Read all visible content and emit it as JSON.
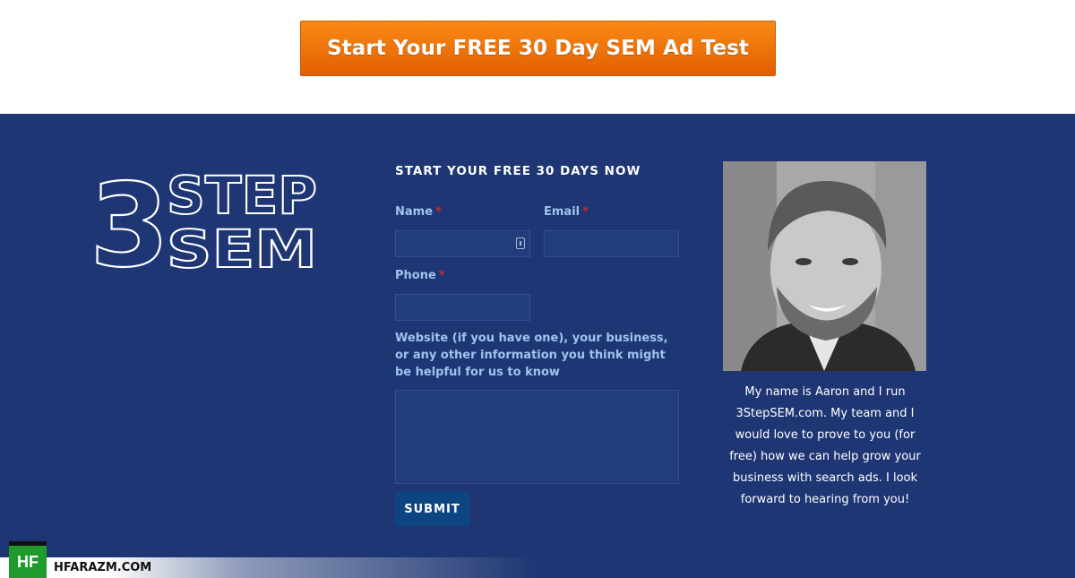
{
  "hero": {
    "cta_label": "Start Your FREE 30 Day SEM Ad Test"
  },
  "logo": {
    "digit": "3",
    "line1": "STEP",
    "line2": "SEM",
    "color": "#ffffff"
  },
  "form": {
    "title": "START YOUR FREE 30 DAYS NOW",
    "name_label": "Name",
    "email_label": "Email",
    "phone_label": "Phone",
    "required_mark": "*",
    "message_label": "Website (if you have one), your business, or any other information you think might be helpful for us to know",
    "name_value": "",
    "email_value": "",
    "phone_value": "",
    "message_value": "",
    "submit_label": "SUBMIT"
  },
  "profile": {
    "bio": "My name is Aaron and I run 3StepSEM.com. My team and I would love to prove to you (for free) how we can help grow your business with search ads. I look forward to hearing from you!"
  },
  "watermark": {
    "badge": "HF",
    "site": "HFARAZM.COM"
  },
  "colors": {
    "accent_orange": "#f07a0a",
    "band_blue": "#1e3673",
    "label_blue": "#9fc3ee",
    "required_red": "#cc2a2a"
  }
}
